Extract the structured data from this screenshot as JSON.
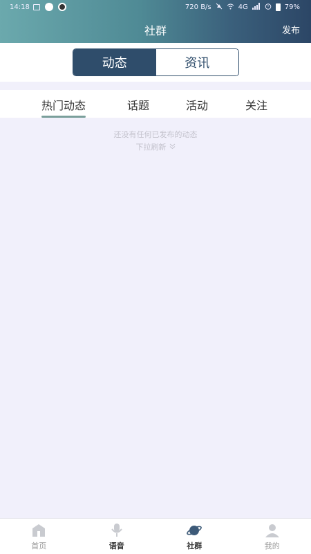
{
  "status_bar": {
    "time": "14:18",
    "speed": "720 B/s",
    "network": "4G",
    "battery": "79%"
  },
  "header": {
    "title": "社群",
    "publish_label": "发布"
  },
  "segment": {
    "tabs": [
      {
        "label": "动态",
        "active": true
      },
      {
        "label": "资讯",
        "active": false
      }
    ]
  },
  "subtabs": [
    {
      "label": "热门动态",
      "active": true
    },
    {
      "label": "话题",
      "active": false
    },
    {
      "label": "活动",
      "active": false
    },
    {
      "label": "关注",
      "active": false
    }
  ],
  "empty_state": {
    "message": "还没有任何已发布的动态",
    "hint": "下拉刷新"
  },
  "bottom_nav": [
    {
      "label": "首页",
      "icon": "home-icon",
      "active": false
    },
    {
      "label": "语音",
      "icon": "microphone-icon",
      "active": false
    },
    {
      "label": "社群",
      "icon": "planet-icon",
      "active": true
    },
    {
      "label": "我的",
      "icon": "user-icon",
      "active": false
    }
  ],
  "colors": {
    "accent": "#2f4d6b",
    "subtab_indicator": "#7a9f9b",
    "background": "#f1f0fb"
  }
}
